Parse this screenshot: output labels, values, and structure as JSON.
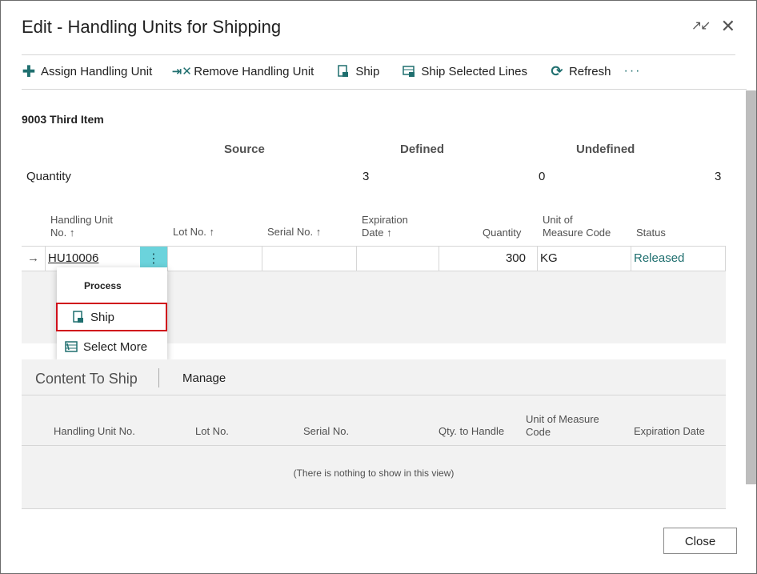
{
  "dialog": {
    "title": "Edit - Handling Units for Shipping",
    "collapse_icon": "collapse-icon",
    "close_icon": "close-icon"
  },
  "toolbar": {
    "assign": "Assign Handling Unit",
    "remove": "Remove Handling Unit",
    "ship": "Ship",
    "ship_selected": "Ship Selected Lines",
    "refresh": "Refresh",
    "more": "···"
  },
  "item": {
    "title": "9003 Third Item",
    "headers": {
      "source": "Source",
      "defined": "Defined",
      "undefined": "Undefined"
    },
    "quantity_label": "Quantity",
    "source_qty": "3",
    "defined_qty": "0",
    "undefined_qty": "3"
  },
  "grid": {
    "columns": {
      "hu_no_1": "Handling Unit",
      "hu_no_2": "No. ↑",
      "lot": "Lot No. ↑",
      "serial": "Serial No. ↑",
      "exp_1": "Expiration",
      "exp_2": "Date ↑",
      "qty": "Quantity",
      "uom_1": "Unit of",
      "uom_2": "Measure Code",
      "status": "Status"
    },
    "row": {
      "arrow": "→",
      "hu_no": "HU10006",
      "lot": "",
      "serial": "",
      "exp": "",
      "qty": "300",
      "uom": "KG",
      "status": "Released"
    },
    "dots": "⋮"
  },
  "context_menu": {
    "header": "Process",
    "ship": "Ship",
    "select_more": "Select More"
  },
  "content_part": {
    "title": "Content To Ship",
    "manage": "Manage",
    "columns": {
      "hu_no": "Handling Unit No.",
      "lot": "Lot No.",
      "serial": "Serial No.",
      "qty_handle": "Qty. to Handle",
      "uom_1": "Unit of Measure",
      "uom_2": "Code",
      "exp": "Expiration Date"
    },
    "empty_text": "(There is nothing to show in this view)"
  },
  "footer": {
    "close": "Close"
  },
  "colors": {
    "accent": "#1f6f6f",
    "highlight": "#d0101b",
    "dots_button": "#6bd3dc"
  }
}
